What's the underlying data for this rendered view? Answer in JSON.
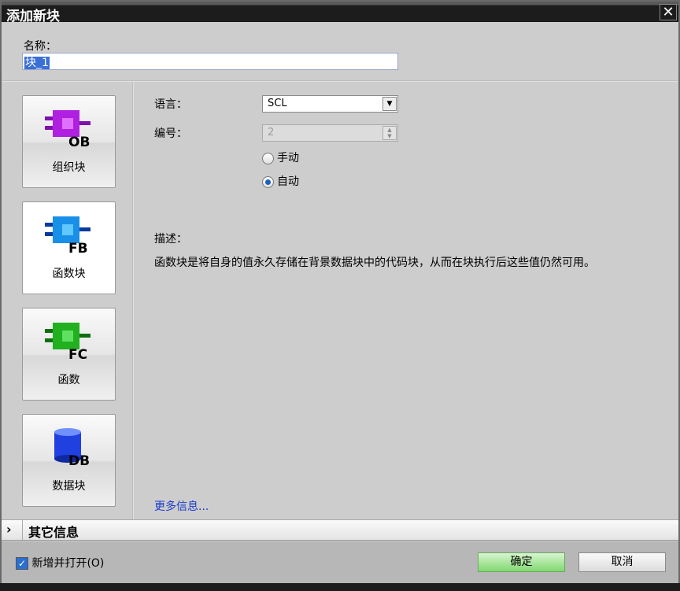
{
  "title": "添加新块",
  "name": {
    "label": "名称：",
    "value": "块_1"
  },
  "blocks": [
    {
      "label": "组织块",
      "code": "OB",
      "color": "#b020e0"
    },
    {
      "label": "函数块",
      "code": "FB",
      "color": "#1890e8"
    },
    {
      "label": "函数",
      "code": "FC",
      "color": "#20b020"
    },
    {
      "label": "数据块",
      "code": "DB",
      "color": "#2040e0"
    }
  ],
  "language": {
    "label": "语言：",
    "value": "SCL"
  },
  "number": {
    "label": "编号：",
    "value": "2",
    "manual": "手动",
    "auto": "自动"
  },
  "description": {
    "label": "描述：",
    "text": "函数块是将自身的值永久存储在背景数据块中的代码块，从而在块执行后这些值仍然可用。"
  },
  "more_info": "更多信息...",
  "other_info": "其它信息",
  "footer": {
    "checkbox": "新增并打开(O)",
    "ok": "确定",
    "cancel": "取消"
  }
}
